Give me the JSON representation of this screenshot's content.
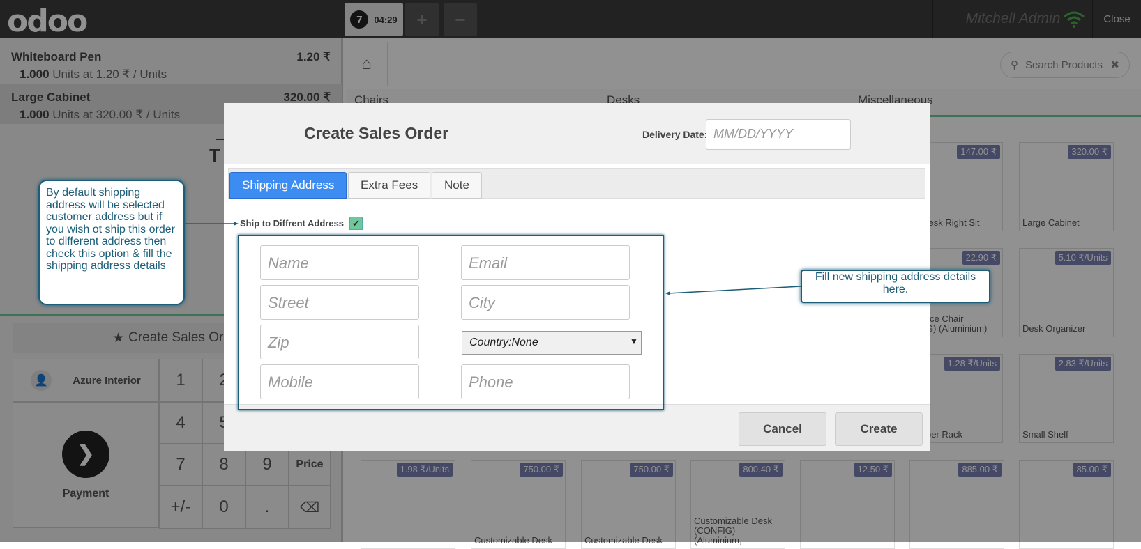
{
  "header": {
    "logo": "odoo",
    "order_number": "7",
    "order_time": "04:29",
    "add_label": "+",
    "remove_label": "−",
    "user": "Mitchell Admin",
    "close_label": "Close"
  },
  "order": {
    "lines": [
      {
        "name": "Whiteboard Pen",
        "price": "1.20 ₹",
        "qty": "1.000",
        "detail": "Units at 1.20 ₹ / Units"
      },
      {
        "name": "Large Cabinet",
        "price": "320.00 ₹",
        "qty": "1.000",
        "detail": "Units at 320.00 ₹ / Units"
      }
    ],
    "total_partial": "T"
  },
  "actions": {
    "create_sales_order": "Create Sales Ord",
    "customer": "Azure Interior",
    "payment": "Payment"
  },
  "keypad": {
    "k1": "1",
    "k2": "2",
    "k4": "4",
    "k5": "5",
    "k7": "7",
    "k8": "8",
    "k9": "9",
    "price": "Price",
    "plusminus": "+/-",
    "k0": "0",
    "dot": ".",
    "backspace": "⌫"
  },
  "products_panel": {
    "search_placeholder": "Search Products",
    "categories": [
      "Chairs",
      "Desks",
      "Miscellaneous"
    ],
    "products": [
      {
        "name": "",
        "price": "147.00 ₹"
      },
      {
        "name": "Large Cabinet",
        "price": "320.00 ₹"
      },
      {
        "name": "er Desk Right Sit",
        "price": ""
      },
      {
        "name": "erence Chair\nNFIG) (Aluminium)",
        "price": "22.90 ₹"
      },
      {
        "name": "Desk Organizer",
        "price": "5.10 ₹/Units"
      },
      {
        "name": "spaper Rack",
        "price": "1.28 ₹/Units"
      },
      {
        "name": "Small Shelf",
        "price": "2.83 ₹/Units"
      },
      {
        "name": "",
        "price": "1.98 ₹/Units"
      },
      {
        "name": "Customizable Desk",
        "price": "750.00 ₹"
      },
      {
        "name": "Customizable Desk",
        "price": "750.00 ₹"
      },
      {
        "name": "Customizable Desk\n(CONFIG) (Aluminium,",
        "price": "800.40 ₹"
      },
      {
        "name": "",
        "price": "12.50 ₹"
      },
      {
        "name": "",
        "price": "885.00 ₹"
      },
      {
        "name": "",
        "price": "85.00 ₹"
      }
    ]
  },
  "modal": {
    "title": "Create Sales Order",
    "delivery_label": "Delivery Date:",
    "delivery_placeholder": "MM/DD/YYYY",
    "tabs": [
      "Shipping Address",
      "Extra Fees",
      "Note"
    ],
    "ship_label": "Ship to Diffrent Address",
    "ship_checked": "✔",
    "fields": {
      "name": "Name",
      "email": "Email",
      "street": "Street",
      "city": "City",
      "zip": "Zip",
      "mobile": "Mobile",
      "phone": "Phone"
    },
    "country": "Country:None",
    "cancel": "Cancel",
    "create": "Create"
  },
  "annotations": {
    "note1": "By default shipping address will be selected customer address but if you wish ot ship this order to different address then check this option & fill the shipping address details",
    "note2": "Fill new shipping address details here."
  },
  "colors": {
    "accent": "#3c8cf2",
    "green": "#6ec89b",
    "annotation": "#1c5d78",
    "price_badge": "#7a81b4"
  }
}
